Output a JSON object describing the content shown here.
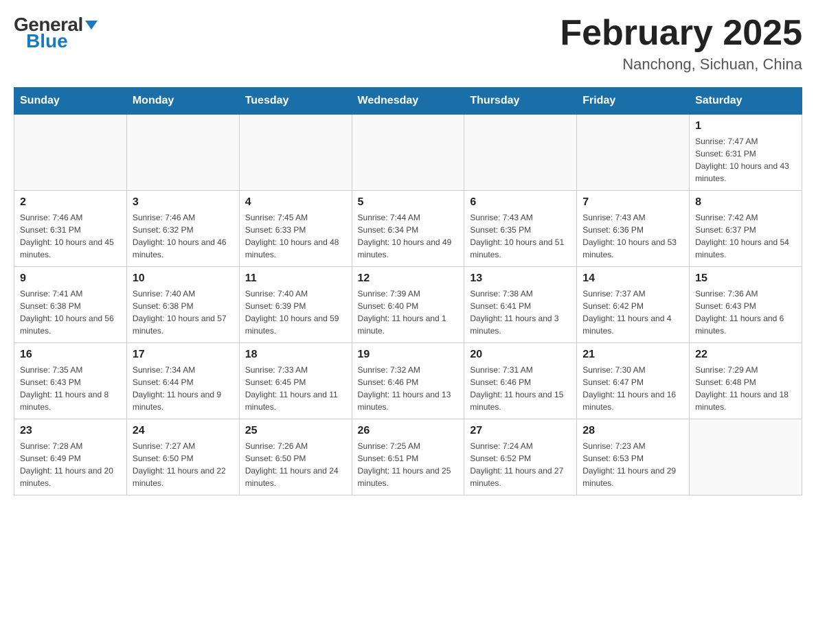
{
  "logo": {
    "general": "General",
    "blue": "Blue",
    "triangle": "▼"
  },
  "title": "February 2025",
  "subtitle": "Nanchong, Sichuan, China",
  "weekdays": [
    "Sunday",
    "Monday",
    "Tuesday",
    "Wednesday",
    "Thursday",
    "Friday",
    "Saturday"
  ],
  "weeks": [
    [
      {
        "day": "",
        "info": ""
      },
      {
        "day": "",
        "info": ""
      },
      {
        "day": "",
        "info": ""
      },
      {
        "day": "",
        "info": ""
      },
      {
        "day": "",
        "info": ""
      },
      {
        "day": "",
        "info": ""
      },
      {
        "day": "1",
        "info": "Sunrise: 7:47 AM\nSunset: 6:31 PM\nDaylight: 10 hours and 43 minutes."
      }
    ],
    [
      {
        "day": "2",
        "info": "Sunrise: 7:46 AM\nSunset: 6:31 PM\nDaylight: 10 hours and 45 minutes."
      },
      {
        "day": "3",
        "info": "Sunrise: 7:46 AM\nSunset: 6:32 PM\nDaylight: 10 hours and 46 minutes."
      },
      {
        "day": "4",
        "info": "Sunrise: 7:45 AM\nSunset: 6:33 PM\nDaylight: 10 hours and 48 minutes."
      },
      {
        "day": "5",
        "info": "Sunrise: 7:44 AM\nSunset: 6:34 PM\nDaylight: 10 hours and 49 minutes."
      },
      {
        "day": "6",
        "info": "Sunrise: 7:43 AM\nSunset: 6:35 PM\nDaylight: 10 hours and 51 minutes."
      },
      {
        "day": "7",
        "info": "Sunrise: 7:43 AM\nSunset: 6:36 PM\nDaylight: 10 hours and 53 minutes."
      },
      {
        "day": "8",
        "info": "Sunrise: 7:42 AM\nSunset: 6:37 PM\nDaylight: 10 hours and 54 minutes."
      }
    ],
    [
      {
        "day": "9",
        "info": "Sunrise: 7:41 AM\nSunset: 6:38 PM\nDaylight: 10 hours and 56 minutes."
      },
      {
        "day": "10",
        "info": "Sunrise: 7:40 AM\nSunset: 6:38 PM\nDaylight: 10 hours and 57 minutes."
      },
      {
        "day": "11",
        "info": "Sunrise: 7:40 AM\nSunset: 6:39 PM\nDaylight: 10 hours and 59 minutes."
      },
      {
        "day": "12",
        "info": "Sunrise: 7:39 AM\nSunset: 6:40 PM\nDaylight: 11 hours and 1 minute."
      },
      {
        "day": "13",
        "info": "Sunrise: 7:38 AM\nSunset: 6:41 PM\nDaylight: 11 hours and 3 minutes."
      },
      {
        "day": "14",
        "info": "Sunrise: 7:37 AM\nSunset: 6:42 PM\nDaylight: 11 hours and 4 minutes."
      },
      {
        "day": "15",
        "info": "Sunrise: 7:36 AM\nSunset: 6:43 PM\nDaylight: 11 hours and 6 minutes."
      }
    ],
    [
      {
        "day": "16",
        "info": "Sunrise: 7:35 AM\nSunset: 6:43 PM\nDaylight: 11 hours and 8 minutes."
      },
      {
        "day": "17",
        "info": "Sunrise: 7:34 AM\nSunset: 6:44 PM\nDaylight: 11 hours and 9 minutes."
      },
      {
        "day": "18",
        "info": "Sunrise: 7:33 AM\nSunset: 6:45 PM\nDaylight: 11 hours and 11 minutes."
      },
      {
        "day": "19",
        "info": "Sunrise: 7:32 AM\nSunset: 6:46 PM\nDaylight: 11 hours and 13 minutes."
      },
      {
        "day": "20",
        "info": "Sunrise: 7:31 AM\nSunset: 6:46 PM\nDaylight: 11 hours and 15 minutes."
      },
      {
        "day": "21",
        "info": "Sunrise: 7:30 AM\nSunset: 6:47 PM\nDaylight: 11 hours and 16 minutes."
      },
      {
        "day": "22",
        "info": "Sunrise: 7:29 AM\nSunset: 6:48 PM\nDaylight: 11 hours and 18 minutes."
      }
    ],
    [
      {
        "day": "23",
        "info": "Sunrise: 7:28 AM\nSunset: 6:49 PM\nDaylight: 11 hours and 20 minutes."
      },
      {
        "day": "24",
        "info": "Sunrise: 7:27 AM\nSunset: 6:50 PM\nDaylight: 11 hours and 22 minutes."
      },
      {
        "day": "25",
        "info": "Sunrise: 7:26 AM\nSunset: 6:50 PM\nDaylight: 11 hours and 24 minutes."
      },
      {
        "day": "26",
        "info": "Sunrise: 7:25 AM\nSunset: 6:51 PM\nDaylight: 11 hours and 25 minutes."
      },
      {
        "day": "27",
        "info": "Sunrise: 7:24 AM\nSunset: 6:52 PM\nDaylight: 11 hours and 27 minutes."
      },
      {
        "day": "28",
        "info": "Sunrise: 7:23 AM\nSunset: 6:53 PM\nDaylight: 11 hours and 29 minutes."
      },
      {
        "day": "",
        "info": ""
      }
    ]
  ]
}
